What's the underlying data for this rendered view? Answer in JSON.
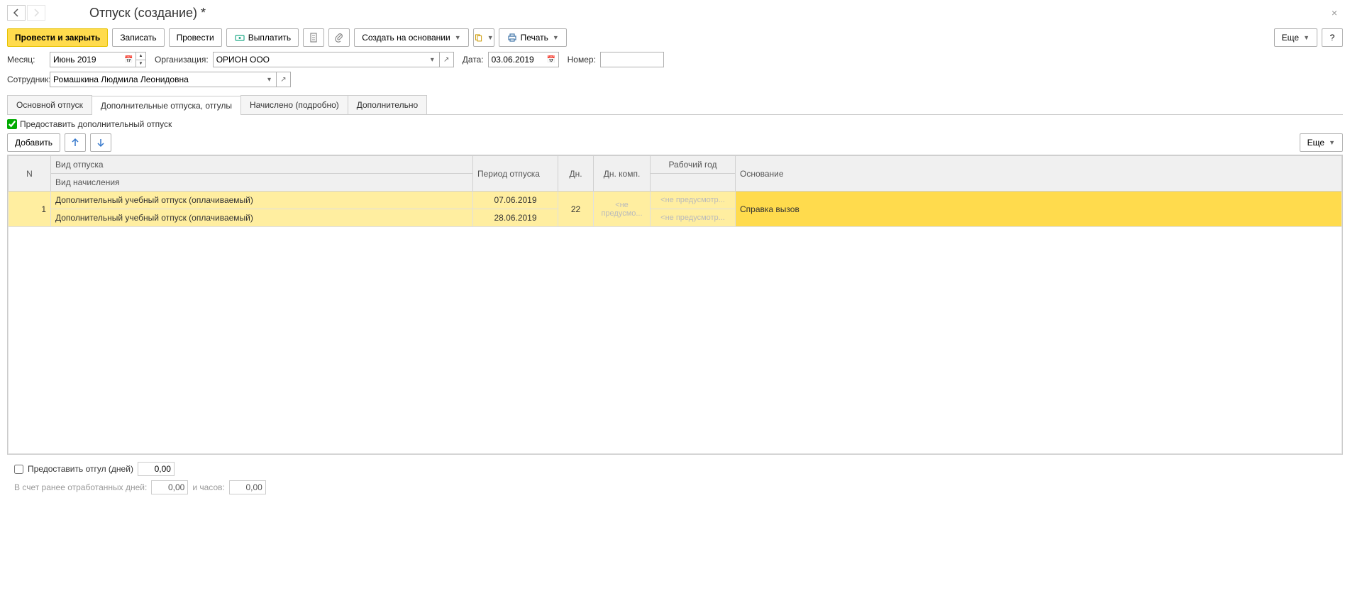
{
  "header": {
    "title": "Отпуск (создание) *"
  },
  "toolbar": {
    "post_close": "Провести и закрыть",
    "save": "Записать",
    "post": "Провести",
    "pay": "Выплатить",
    "create_based": "Создать на основании",
    "print": "Печать",
    "more": "Еще",
    "help": "?"
  },
  "fields": {
    "month_label": "Месяц:",
    "month_value": "Июнь 2019",
    "org_label": "Организация:",
    "org_value": "ОРИОН ООО",
    "date_label": "Дата:",
    "date_value": "03.06.2019",
    "number_label": "Номер:",
    "number_value": "",
    "employee_label": "Сотрудник:",
    "employee_value": "Ромашкина Людмила Леонидовна"
  },
  "tabs": [
    {
      "label": "Основной отпуск",
      "active": false
    },
    {
      "label": "Дополнительные отпуска, отгулы",
      "active": true
    },
    {
      "label": "Начислено (подробно)",
      "active": false
    },
    {
      "label": "Дополнительно",
      "active": false
    }
  ],
  "tab_additional": {
    "provide_extra_label": "Предоставить дополнительный отпуск",
    "provide_extra_checked": true,
    "add_btn": "Добавить",
    "more_btn": "Еще",
    "columns": {
      "n": "N",
      "type": "Вид отпуска",
      "accrual": "Вид начисления",
      "period": "Период отпуска",
      "days": "Дн.",
      "comp": "Дн. комп.",
      "year": "Рабочий год",
      "basis": "Основание"
    },
    "rows": [
      {
        "n": "1",
        "type": "Дополнительный учебный отпуск (оплачиваемый)",
        "accrual": "Дополнительный учебный отпуск (оплачиваемый)",
        "period_from": "07.06.2019",
        "period_to": "28.06.2019",
        "days": "22",
        "comp": "<не предусмо...",
        "year1": "<не предусмотр...",
        "year2": "<не предусмотр...",
        "basis": "Справка вызов"
      }
    ],
    "provide_compensatory_label": "Предоставить отгул (дней)",
    "compensatory_value": "0,00",
    "prev_days_label": "В счет ранее отработанных дней:",
    "prev_days_value": "0,00",
    "hours_label": "и часов:",
    "hours_value": "0,00"
  }
}
